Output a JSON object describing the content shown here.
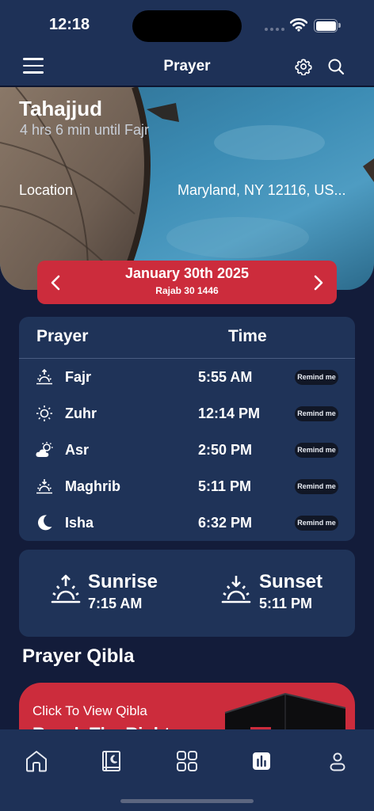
{
  "status_bar": {
    "time": "12:18"
  },
  "header": {
    "title": "Prayer"
  },
  "hero": {
    "current_prayer": "Tahajjud",
    "countdown": "4 hrs 6 min until Fajr",
    "location_label": "Location",
    "location_value": "Maryland, NY 12116, US..."
  },
  "date": {
    "gregorian": "January 30th 2025",
    "hijri": "Rajab 30 1446"
  },
  "prayer_table": {
    "header_prayer": "Prayer",
    "header_time": "Time",
    "rows": [
      {
        "name": "Fajr",
        "time": "5:55 AM",
        "remind": "Remind me",
        "icon": "sunrise-icon"
      },
      {
        "name": "Zuhr",
        "time": "12:14 PM",
        "remind": "Remind me",
        "icon": "sun-icon"
      },
      {
        "name": "Asr",
        "time": "2:50 PM",
        "remind": "Remind me",
        "icon": "partly-cloudy-icon"
      },
      {
        "name": "Maghrib",
        "time": "5:11 PM",
        "remind": "Remind me",
        "icon": "sunset-icon"
      },
      {
        "name": "Isha",
        "time": "6:32 PM",
        "remind": "Remind me",
        "icon": "moon-icon"
      }
    ]
  },
  "sun_times": {
    "sunrise_label": "Sunrise",
    "sunrise_time": "7:15 AM",
    "sunset_label": "Sunset",
    "sunset_time": "5:11 PM"
  },
  "qibla": {
    "section_title": "Prayer Qibla",
    "card_label": "Click To View Qibla",
    "card_heading": "Reach The Right"
  },
  "tab_bar": {
    "items": [
      "home-icon",
      "quran-icon",
      "grid-icon",
      "stats-icon",
      "profile-icon"
    ],
    "active": "stats-icon"
  },
  "colors": {
    "accent": "#cc2c3c",
    "card": "#1f3358",
    "header": "#1e3157",
    "background": "#131c3a"
  }
}
